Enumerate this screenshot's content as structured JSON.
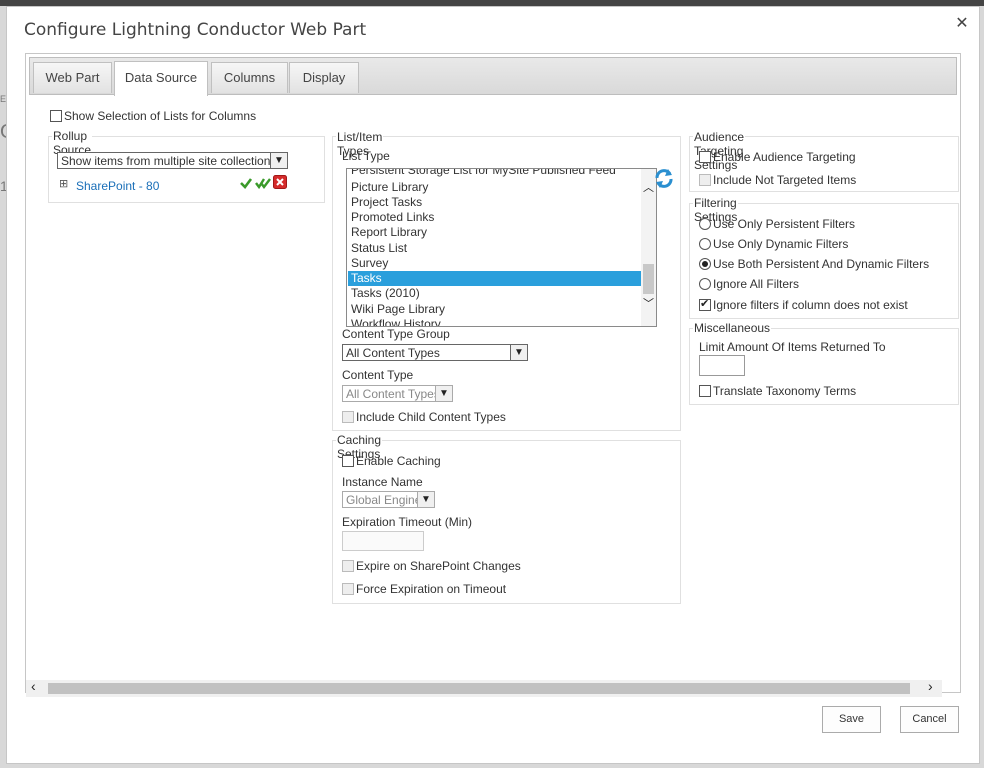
{
  "dialog": {
    "title": "Configure Lightning Conductor Web Part",
    "close_label": "✕"
  },
  "tabs": [
    {
      "label": "Web Part"
    },
    {
      "label": "Data Source"
    },
    {
      "label": "Columns"
    },
    {
      "label": "Display"
    }
  ],
  "active_tab": "Data Source",
  "show_selection": {
    "label": "Show Selection of Lists for Columns",
    "checked": false
  },
  "rollup": {
    "legend": "Rollup Source",
    "scope_value": "Show items from multiple site collections",
    "site_label": "SharePoint - 80",
    "expand_symbol": "⊞"
  },
  "list_types": {
    "legend": "List/Item Types",
    "list_type_label": "List Type",
    "items": [
      "Persistent Storage List for MySite Published Feed",
      "Picture Library",
      "Project Tasks",
      "Promoted Links",
      "Report Library",
      "Status List",
      "Survey",
      "Tasks",
      "Tasks (2010)",
      "Wiki Page Library",
      "Workflow History"
    ],
    "selected": "Tasks",
    "content_type_group_label": "Content Type Group",
    "content_type_group_value": "All Content Types",
    "content_type_label": "Content Type",
    "content_type_value": "All Content Types",
    "include_child_label": "Include Child Content Types"
  },
  "caching": {
    "legend": "Caching Settings",
    "enable_label": "Enable Caching",
    "instance_name_label": "Instance Name",
    "instance_name_value": "Global Engine",
    "expiration_label": "Expiration Timeout (Min)",
    "expire_sp_label": "Expire on SharePoint Changes",
    "force_expire_label": "Force Expiration on Timeout"
  },
  "audience": {
    "legend": "Audience Targeting Settings",
    "enable_label": "Enable Audience Targeting",
    "include_not_targeted_label": "Include Not Targeted Items"
  },
  "filtering": {
    "legend": "Filtering Settings",
    "options": [
      "Use Only Persistent Filters",
      "Use Only Dynamic Filters",
      "Use Both Persistent And Dynamic Filters",
      "Ignore All Filters"
    ],
    "selected": "Use Both Persistent And Dynamic Filters",
    "ignore_missing_label": "Ignore filters if column does not exist",
    "ignore_missing_checked": true
  },
  "misc": {
    "legend": "Miscellaneous",
    "limit_label": "Limit Amount Of Items Returned To",
    "translate_label": "Translate Taxonomy Terms"
  },
  "footer": {
    "save_label": "Save",
    "cancel_label": "Cancel"
  },
  "background": {
    "partial_chars": [
      "E",
      "O",
      "1"
    ]
  },
  "colors": {
    "selection": "#2a9fdc",
    "link": "#1a6fb8",
    "check_green": "#3a9a2a",
    "delete_red": "#d52b2b"
  },
  "icons": [
    "refresh-icon",
    "check-icon",
    "double-check-icon",
    "delete-icon",
    "expand-icon"
  ]
}
